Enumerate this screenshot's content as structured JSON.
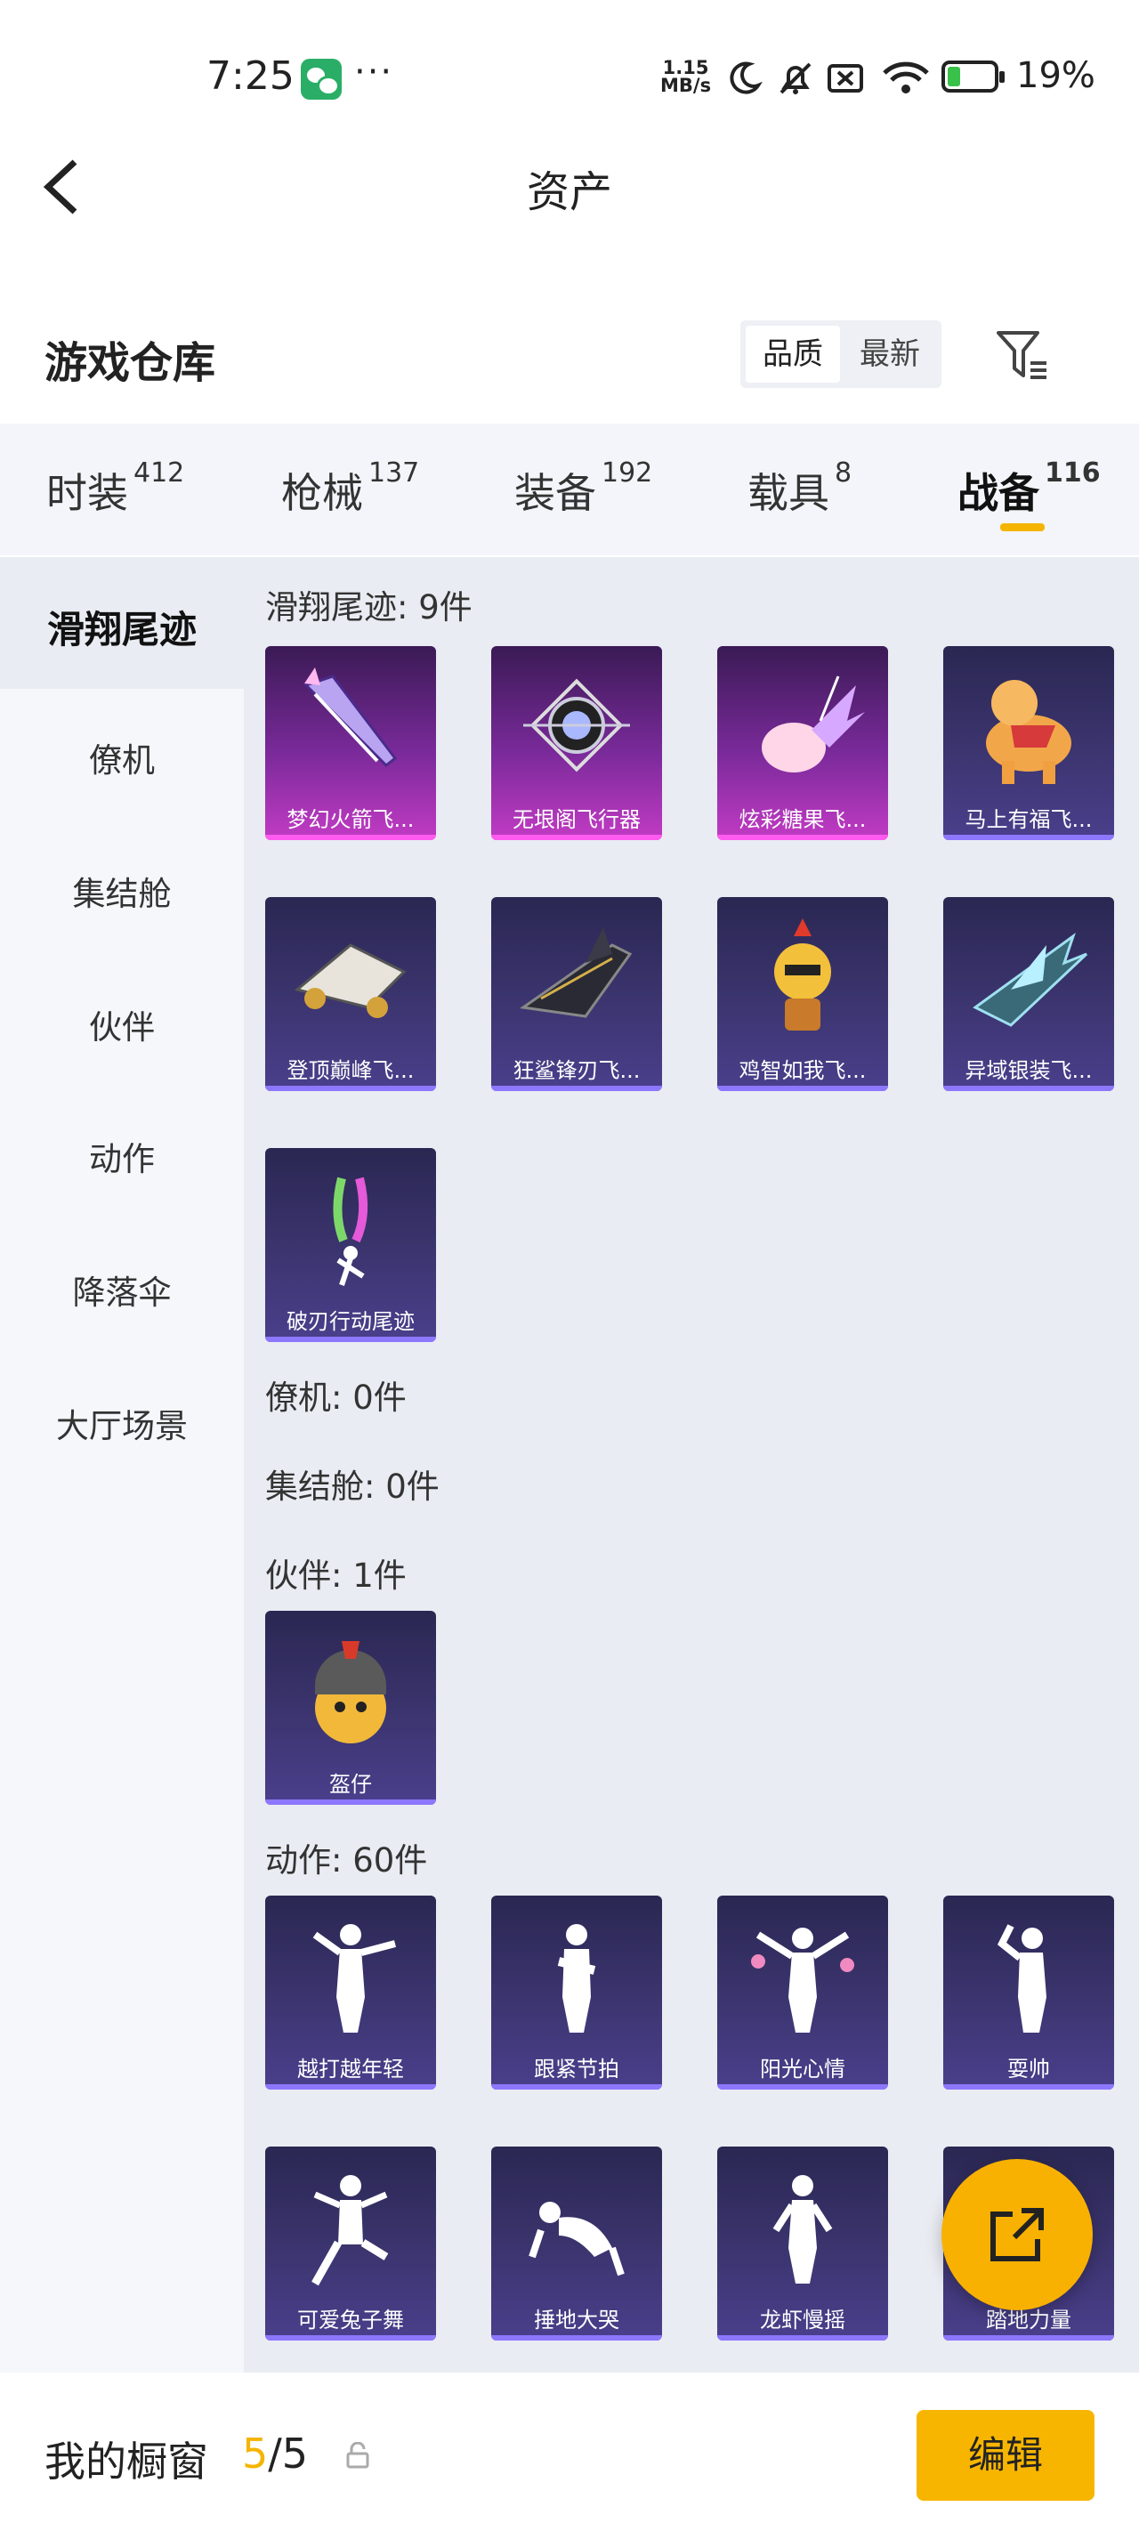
{
  "status_bar": {
    "time": "7:25",
    "ellipsis": "···",
    "speed_value": "1.15",
    "speed_unit": "MB/s",
    "battery": "19%",
    "icons": [
      "wechat-icon",
      "moon-icon",
      "mute-icon",
      "no-sim-icon",
      "wifi-icon",
      "battery-icon"
    ]
  },
  "header": {
    "title": "资产"
  },
  "warehouse": {
    "title": "游戏仓库",
    "sort": [
      "品质",
      "最新"
    ]
  },
  "tabs": [
    {
      "label": "时装",
      "count": "412"
    },
    {
      "label": "枪械",
      "count": "137"
    },
    {
      "label": "装备",
      "count": "192"
    },
    {
      "label": "载具",
      "count": "8"
    },
    {
      "label": "战备",
      "count": "116"
    }
  ],
  "sidebar": [
    "滑翔尾迹",
    "僚机",
    "集结舱",
    "伙伴",
    "动作",
    "降落伞",
    "大厅场景"
  ],
  "sections": {
    "glide": {
      "title": "滑翔尾迹: 9件",
      "items": [
        "梦幻火箭飞...",
        "无垠阁飞行器",
        "炫彩糖果飞...",
        "马上有福飞...",
        "登顶巅峰飞...",
        "狂鲨锋刃飞...",
        "鸡智如我飞...",
        "异域银装飞...",
        "破刃行动尾迹"
      ]
    },
    "wingman": {
      "title": "僚机: 0件"
    },
    "capsule": {
      "title": "集结舱: 0件"
    },
    "partner": {
      "title": "伙伴: 1件",
      "items": [
        "盔仔"
      ]
    },
    "emote": {
      "title": "动作: 60件",
      "items": [
        "越打越年轻",
        "跟紧节拍",
        "阳光心情",
        "耍帅",
        "可爱兔子舞",
        "捶地大哭",
        "龙虾慢摇",
        "踏地力量"
      ]
    }
  },
  "bottom": {
    "label": "我的橱窗",
    "count_current": "5",
    "count_sep_total": "/5",
    "edit": "编辑"
  },
  "colors": {
    "accent": "#f5b400",
    "card_dark": "#2a2752",
    "card_purple": "#c23bc4"
  }
}
